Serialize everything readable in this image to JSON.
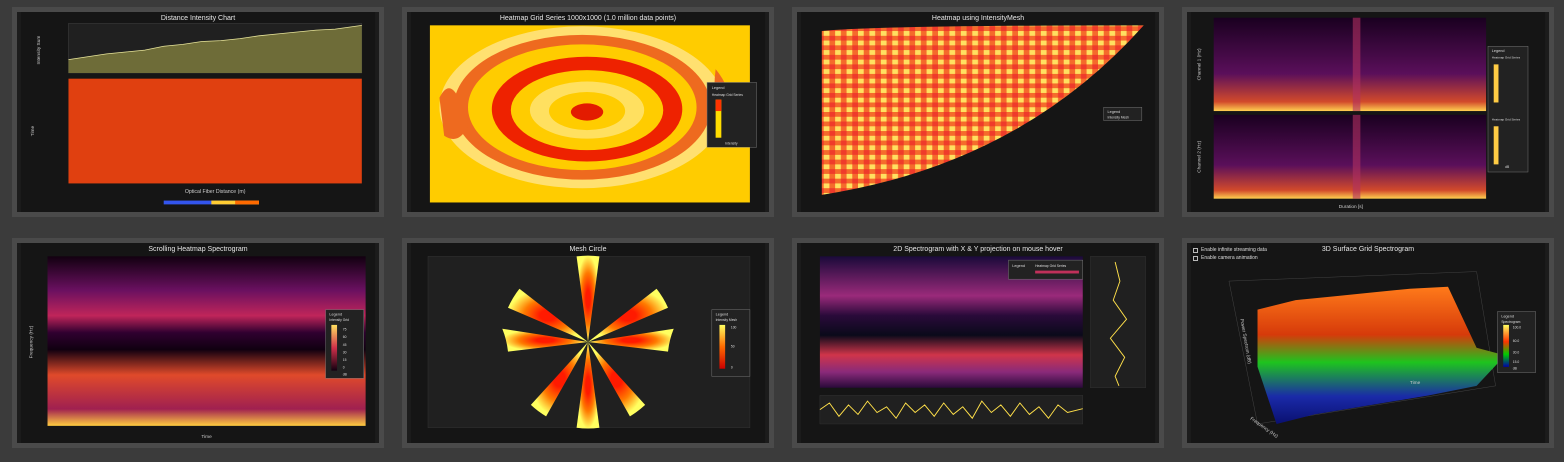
{
  "tiles": [
    {
      "title": "Distance Intensity Chart",
      "y1": "Intensity Sum",
      "y2": "Time",
      "xlabel": "Optical Fiber Distance (m)"
    },
    {
      "title": "Heatmap Grid Series 1000x1000 (1.0 million data points)",
      "legend": "Legend",
      "series": "Heatmap Grid Series",
      "unit": "Intensity"
    },
    {
      "title": "Heatmap using IntensityMesh",
      "legend": "Legend",
      "series": "Intensity Mesh"
    },
    {
      "title": "",
      "xlabel": "Duration [s]",
      "y1": "Channel 1 (Hz)",
      "y2": "Channel 2 (Hz)",
      "legend": "Legend",
      "series": "Heatmap Grid Series",
      "unit": "dB"
    },
    {
      "title": "Scrolling Heatmap Spectrogram",
      "xlabel": "Time",
      "ylabel": "Frequency (Hz)",
      "legend": "Legend",
      "series": "Intensity Grid",
      "unit": "dB",
      "ticks": [
        "75",
        "60",
        "45",
        "30",
        "15",
        "0"
      ]
    },
    {
      "title": "Mesh Circle",
      "legend": "Legend",
      "series": "Intensity Mesh",
      "ticks": [
        "100",
        "50",
        "0"
      ]
    },
    {
      "title": "2D Spectrogram with X & Y projection on mouse hover",
      "legend": "Legend",
      "series": "Heatmap Grid Series"
    },
    {
      "title": "3D Surface Grid Spectrogram",
      "opt1": "Enable infinite streaming data",
      "opt2": "Enable camera animation",
      "legend": "Legend",
      "series": "Spectrogram",
      "xlabel": "Time",
      "ylabel": "Frequency (Hz)",
      "zlabel": "Power Spectrum (dB)",
      "ticks": [
        "100.0",
        "60.0",
        "30.0",
        "15.0",
        "dB"
      ]
    }
  ],
  "colors": {
    "page": "#3b3b3b",
    "tile_border": "#4a4a4a",
    "tile_bg": "#1c1c1c"
  }
}
